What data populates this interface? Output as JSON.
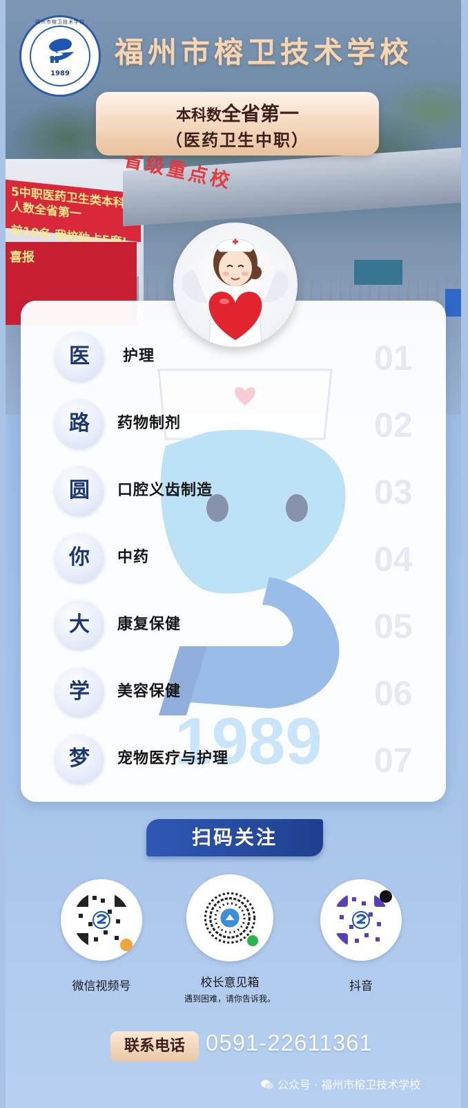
{
  "header": {
    "logo": {
      "ring_text": "FUZHOU RONGWEI TECHNICAL SCHOOL",
      "year": "1989",
      "top_text": "福州市榕卫技术学校"
    },
    "school_name": "福州市榕卫技术学校",
    "rank_card": {
      "prefix": "本科数",
      "highlight": "全省第一",
      "subtitle": "（医药卫生中职）"
    }
  },
  "photo": {
    "banner_text_1": "5中职医药卫生类本科人数全省第一",
    "banner_text_2": "前10名  我校独占5席!",
    "board_title": "喜报",
    "gate_sign": "省级重点校"
  },
  "majors": [
    {
      "char": "医",
      "name": "护理",
      "num": "01"
    },
    {
      "char": "路",
      "name": "药物制剂",
      "num": "02"
    },
    {
      "char": "圆",
      "name": "口腔义齿制造",
      "num": "03"
    },
    {
      "char": "你",
      "name": "中药",
      "num": "04"
    },
    {
      "char": "大",
      "name": "康复保健",
      "num": "05"
    },
    {
      "char": "学",
      "name": "美容保健",
      "num": "06"
    },
    {
      "char": "梦",
      "name": "宠物医疗与护理",
      "num": "07"
    }
  ],
  "mascot_year": "1989",
  "follow": {
    "title": "扫码关注",
    "qrs": [
      {
        "label": "微信视频号",
        "sub": ""
      },
      {
        "label": "校长意见箱",
        "sub": "遇到困难，请你告诉我。"
      },
      {
        "label": "抖音",
        "sub": ""
      }
    ]
  },
  "contact": {
    "label": "联系电话",
    "phone": "0591-22611361"
  },
  "watermark": "公众号 · 福州市榕卫技术学校",
  "colors": {
    "navy": "#1c3776",
    "gold": "#e9c19c",
    "banner": "#2f59b5",
    "red": "#d9283a"
  }
}
